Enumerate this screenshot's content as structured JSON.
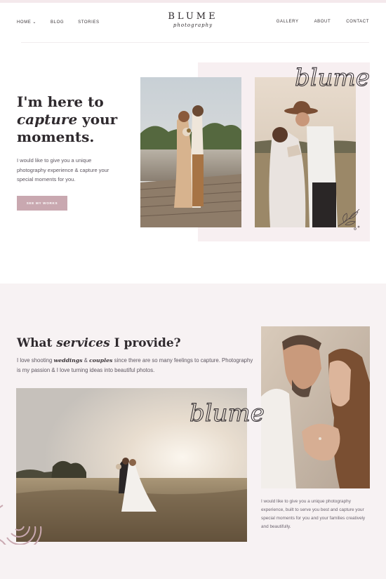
{
  "header": {
    "logo_word": "BLUME",
    "logo_sub": "photography",
    "nav_left": [
      {
        "label": "HOME",
        "has_dropdown": true
      },
      {
        "label": "BLOG"
      },
      {
        "label": "STORIES"
      }
    ],
    "nav_right": [
      {
        "label": "GALLERY"
      },
      {
        "label": "ABOUT"
      },
      {
        "label": "CONTACT"
      }
    ]
  },
  "hero": {
    "title_line1": "I'm here to",
    "title_emph": "capture",
    "title_line2_rest": " your",
    "title_line3": "moments.",
    "text": "I would like to give you a unique photography experience & capture your special moments for you.",
    "button_label": "SEE MY WORKS",
    "script_word": "blume"
  },
  "services": {
    "title_pre": "What ",
    "title_emph": "services",
    "title_post": " I provide?",
    "text_1": "I love shooting ",
    "text_emph1": "weddings",
    "text_2": " & ",
    "text_emph2": "couples",
    "text_3": " since there are so many feelings to capture. Photography is my passion & I love turning ideas into beautiful photos.",
    "script_word": "blume",
    "side_text": "I would like to give you a unique photography experience, built to serve you best and capture your special moments for you and your families creatively and beautifully."
  },
  "colors": {
    "accent": "#c9a8b0",
    "panel_bg": "#f7eff1",
    "section_bg": "#f7f2f3",
    "text_dark": "#2f2a2e"
  }
}
